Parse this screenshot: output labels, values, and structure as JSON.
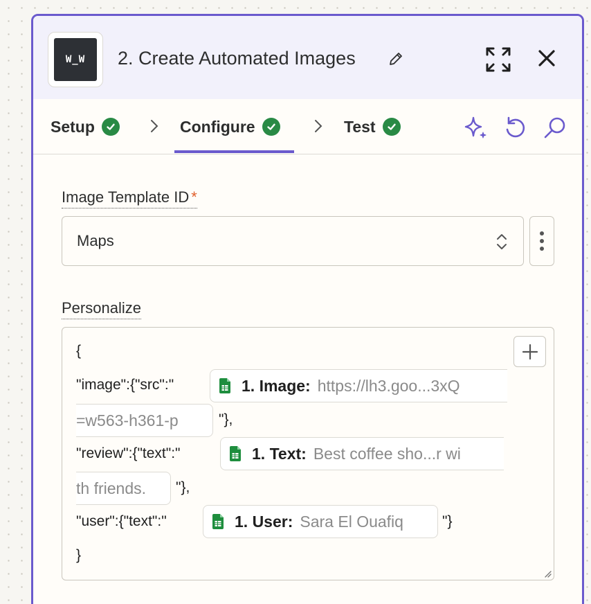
{
  "header": {
    "app_logo_text": "W_W",
    "step_title": "2. Create Automated Images"
  },
  "tabs": [
    {
      "label": "Setup",
      "status": "complete"
    },
    {
      "label": "Configure",
      "status": "complete",
      "active": true
    },
    {
      "label": "Test",
      "status": "complete"
    }
  ],
  "fields": {
    "template": {
      "label": "Image Template ID",
      "required_mark": "*",
      "value": "Maps"
    },
    "personalize": {
      "label": "Personalize",
      "lines": {
        "open_brace": "{",
        "image_prefix": "\"image\":{\"src\":\"",
        "image_suffix": "\"},",
        "review_prefix": "\"review\":{\"text\":\"",
        "review_suffix": "\"},",
        "user_prefix": "\"user\":{\"text\":\"",
        "user_suffix": "\"}",
        "close_brace": "}"
      },
      "pills": {
        "image": {
          "key": "1. Image:",
          "value_start": "https://lh3.goo...3xQ",
          "value_end": "=w563-h361-p"
        },
        "text": {
          "key": "1. Text:",
          "value_start": "Best coffee sho...r wi",
          "value_end": "th friends."
        },
        "user": {
          "key": "1. User:",
          "value": "Sara El Ouafiq"
        }
      }
    }
  },
  "colors": {
    "accent": "#6a5acd",
    "success": "#298a45",
    "required": "#e05f2b",
    "sheets_green": "#1e8e3e"
  }
}
